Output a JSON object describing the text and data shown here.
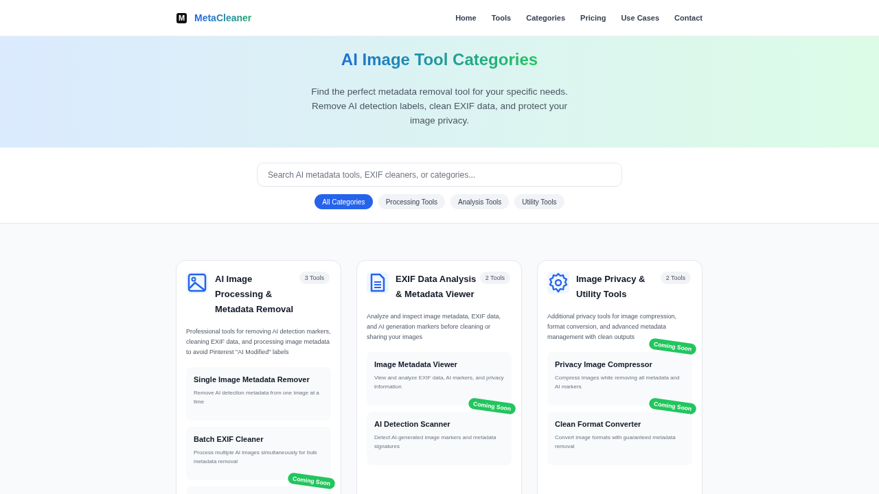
{
  "brand": {
    "logo": "M",
    "name": "MetaCleaner"
  },
  "nav": [
    "Home",
    "Tools",
    "Categories",
    "Pricing",
    "Use Cases",
    "Contact"
  ],
  "hero": {
    "title": "AI Image Tool Categories",
    "subtitle": "Find the perfect metadata removal tool for your specific needs. Remove AI detection labels, clean EXIF data, and protect your image privacy."
  },
  "search": {
    "placeholder": "Search AI metadata tools, EXIF cleaners, or categories..."
  },
  "filters": [
    {
      "label": "All Categories",
      "selected": true
    },
    {
      "label": "Processing Tools",
      "selected": false
    },
    {
      "label": "Analysis Tools",
      "selected": false
    },
    {
      "label": "Utility Tools",
      "selected": false
    }
  ],
  "categories": [
    {
      "kind": "image",
      "title": "AI Image Processing & Metadata Removal",
      "count": "3 Tools",
      "description": "Professional tools for removing AI detection markers, cleaning EXIF data, and processing image metadata to avoid Pinterest \"AI Modified\" labels",
      "tools": [
        {
          "name": "Single Image Metadata Remover",
          "description": "Remove AI detection metadata from one image at a time",
          "coming_soon": false
        },
        {
          "name": "Batch EXIF Cleaner",
          "description": "Process multiple AI images simultaneously for bulk metadata removal",
          "coming_soon": false
        },
        {
          "coming_soon": true,
          "badge": "Coming Soon"
        }
      ]
    },
    {
      "kind": "document",
      "title": "EXIF Data Analysis & Metadata Viewer",
      "count": "2 Tools",
      "description": "Analyze and inspect image metadata, EXIF data, and AI generation markers before cleaning or sharing your images",
      "tools": [
        {
          "name": "Image Metadata Viewer",
          "description": "View and analyze EXIF data, AI markers, and privacy information",
          "coming_soon": false
        },
        {
          "name": "AI Detection Scanner",
          "description": "Detect AI-generated image markers and metadata signatures",
          "coming_soon": true,
          "badge": "Coming Soon"
        }
      ]
    },
    {
      "kind": "gear",
      "title": "Image Privacy & Utility Tools",
      "count": "2 Tools",
      "description": "Additional privacy tools for image compression, format conversion, and advanced metadata management with clean outputs",
      "tools": [
        {
          "name": "Privacy Image Compressor",
          "description": "Compress images while removing all metadata and AI markers",
          "coming_soon": true,
          "badge": "Coming Soon"
        },
        {
          "name": "Clean Format Converter",
          "description": "Convert image formats with guaranteed metadata removal",
          "coming_soon": true,
          "badge": "Coming Soon"
        }
      ]
    }
  ]
}
